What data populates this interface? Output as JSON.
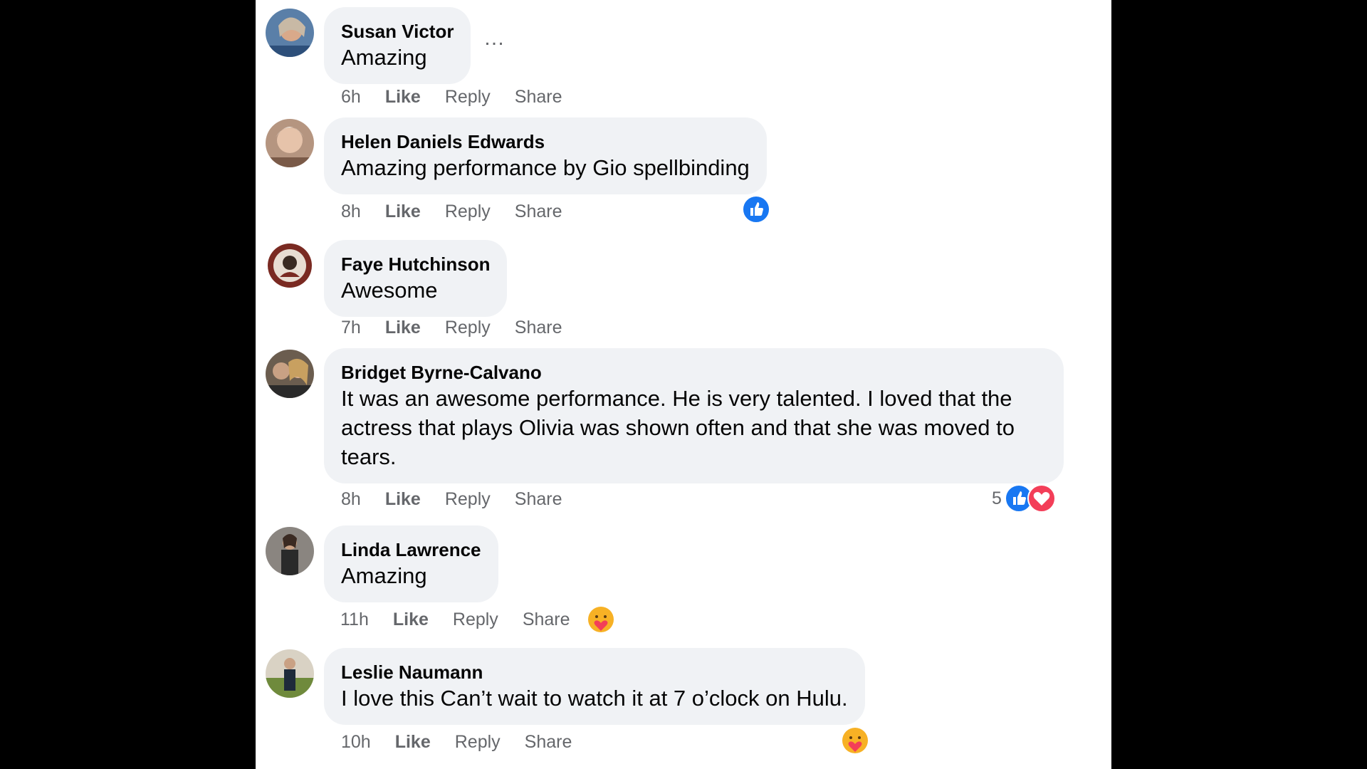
{
  "colors": {
    "bubble": "#f0f2f5",
    "secondary_text": "#65676b",
    "like_blue": "#1877f2",
    "love_red": "#f33e58"
  },
  "actions": {
    "like": "Like",
    "reply": "Reply",
    "share": "Share"
  },
  "more_options": "…",
  "comments": [
    {
      "author": "Susan Victor",
      "text": "Amazing",
      "time": "6h",
      "reactions": []
    },
    {
      "author": "Helen Daniels Edwards",
      "text": "Amazing performance by Gio spellbinding",
      "time": "8h",
      "reactions": [
        "like"
      ]
    },
    {
      "author": "Faye Hutchinson",
      "text": "Awesome",
      "time": "7h",
      "reactions": []
    },
    {
      "author": "Bridget Byrne-Calvano",
      "text": "It was an awesome performance. He is very talented. I loved that the actress that plays Olivia was shown often and that she was moved to tears.",
      "time": "8h",
      "reactions": [
        "like",
        "love"
      ],
      "reaction_count": "5"
    },
    {
      "author": "Linda Lawrence",
      "text": "Amazing",
      "time": "11h",
      "reactions": [
        "care"
      ]
    },
    {
      "author": "Leslie Naumann",
      "text": "I love this Can’t wait to watch it at 7 o’clock on Hulu.",
      "time": "10h",
      "reactions": [
        "care"
      ]
    }
  ]
}
